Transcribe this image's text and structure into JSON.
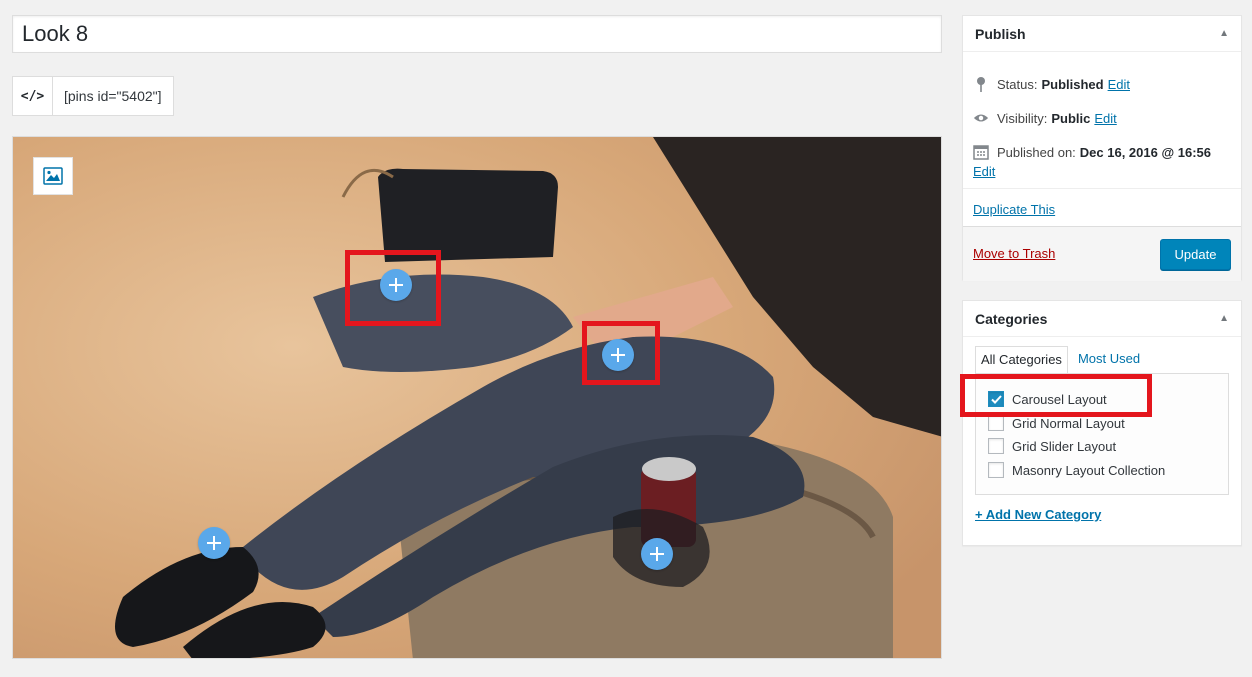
{
  "post": {
    "title": "Look 8",
    "shortcode_button": "</>",
    "shortcode": "[pins id=\"5402\"]"
  },
  "image_editor": {
    "media_button_icon": "image-icon",
    "pins": [
      {
        "name": "pin-bag"
      },
      {
        "name": "pin-wrist"
      },
      {
        "name": "pin-shoe"
      },
      {
        "name": "pin-can"
      }
    ],
    "highlight_color": "#e4161d",
    "pin_color": "#5aa8ea"
  },
  "publish": {
    "title": "Publish",
    "toggle_icon": "▲",
    "status_label": "Status:",
    "status_value": "Published",
    "visibility_label": "Visibility:",
    "visibility_value": "Public",
    "published_label": "Published on:",
    "published_value": "Dec 16, 2016 @ 16:56",
    "edit": "Edit",
    "duplicate": "Duplicate This",
    "trash": "Move to Trash",
    "update": "Update"
  },
  "categories": {
    "title": "Categories",
    "toggle_icon": "▲",
    "tabs": [
      "All Categories",
      "Most Used"
    ],
    "items": [
      {
        "label": "Carousel Layout",
        "checked": true
      },
      {
        "label": "Grid Normal Layout",
        "checked": false
      },
      {
        "label": "Grid Slider Layout",
        "checked": false
      },
      {
        "label": "Masonry Layout Collection",
        "checked": false
      }
    ],
    "add_new": "+ Add New Category"
  },
  "colors": {
    "accent": "#0073aa",
    "button": "#0085ba",
    "trash": "#a00"
  }
}
